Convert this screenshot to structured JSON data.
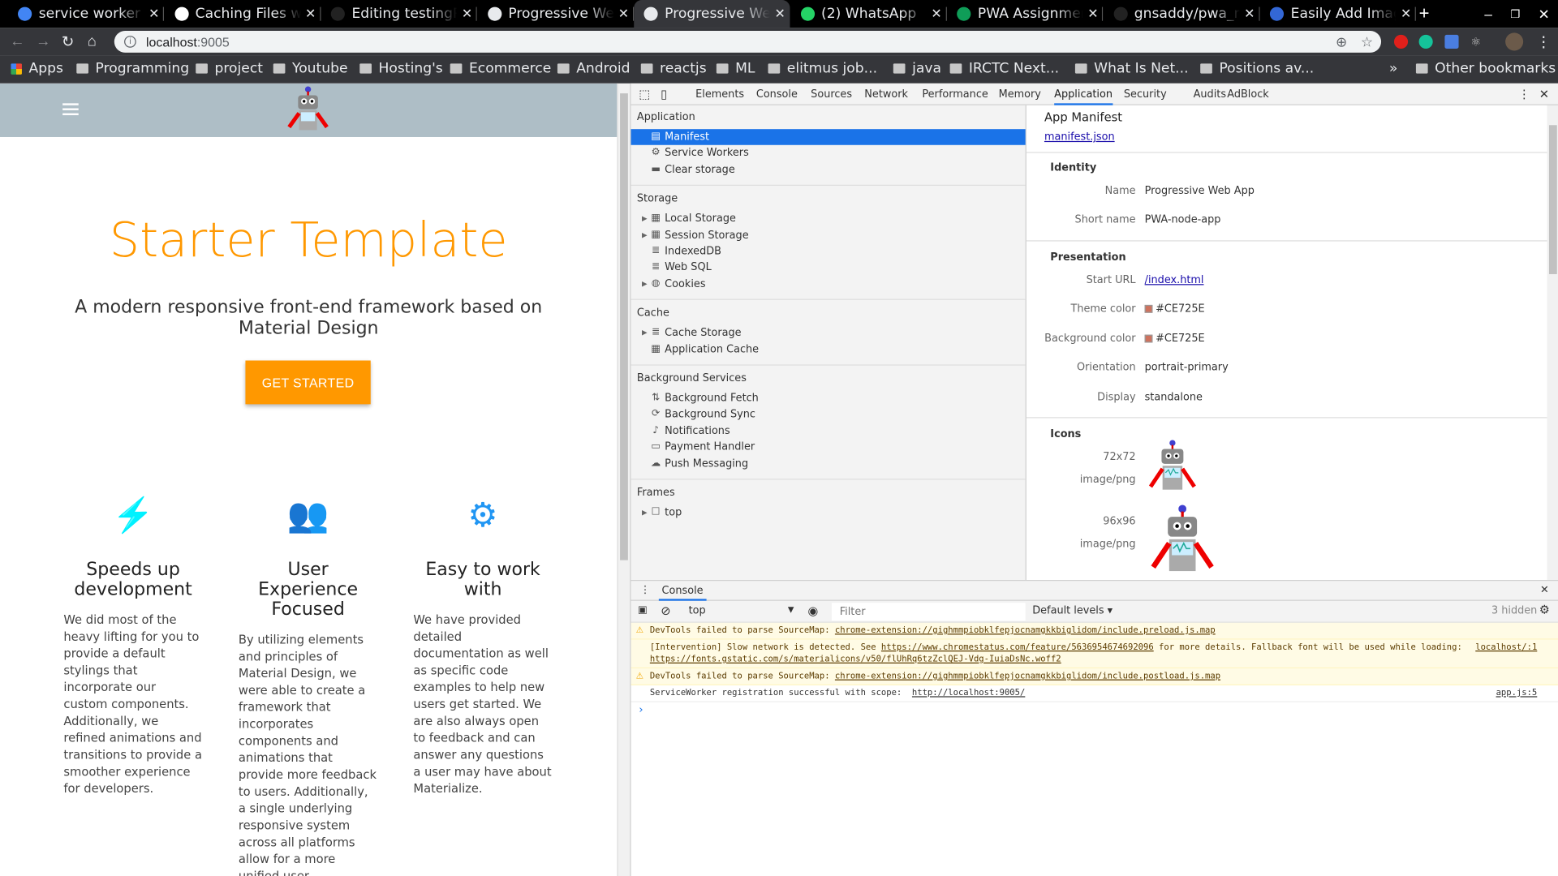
{
  "browser": {
    "tabs": [
      {
        "title": "service worker t",
        "favicon": "google-icon",
        "color": "#4285f4"
      },
      {
        "title": "Caching Files wi",
        "favicon": "web-dev-icon",
        "color": "#ffffff"
      },
      {
        "title": "Editing testingP",
        "favicon": "github-icon",
        "color": "#222222"
      },
      {
        "title": "Progressive Wel",
        "favicon": "globe-icon",
        "color": "#e8eaed"
      },
      {
        "title": "Progressive Wel",
        "favicon": "globe-icon",
        "color": "#e8eaed",
        "active": true
      },
      {
        "title": "(2) WhatsApp",
        "favicon": "whatsapp-icon",
        "color": "#25d366"
      },
      {
        "title": "PWA Assignmen",
        "favicon": "sheets-icon",
        "color": "#0f9d58"
      },
      {
        "title": "gnsaddy/pwa_n",
        "favicon": "github-icon",
        "color": "#222222"
      },
      {
        "title": "Easily Add Imag",
        "favicon": "angular-icon",
        "color": "#3367d6"
      }
    ],
    "url_host": "localhost",
    "url_port": ":9005",
    "bookmarks": [
      "Apps",
      "Programming",
      "project",
      "Youtube",
      "Hosting's",
      "Ecommerce",
      "Android",
      "reactjs",
      "ML",
      "elitmus job...",
      "java",
      "IRCTC Next...",
      "What Is Net...",
      "Positions av..."
    ],
    "other_bookmarks": "Other bookmarks",
    "more": "»"
  },
  "page": {
    "title": "Starter Template",
    "subtitle": "A modern responsive front-end framework based on Material Design",
    "cta": "GET STARTED",
    "accent": "#ff9800",
    "header_color": "#aebec6",
    "features": [
      {
        "icon": "flash-icon",
        "title": "Speeds up development",
        "text": "We did most of the heavy lifting for you to provide a default stylings that incorporate our custom components. Additionally, we refined animations and transitions to provide a smoother experience for developers."
      },
      {
        "icon": "group-icon",
        "title": "User Experience Focused",
        "text": "By utilizing elements and principles of Material Design, we were able to create a framework that incorporates components and animations that provide more feedback to users. Additionally, a single underlying responsive system across all platforms allow for a more unified user experience."
      },
      {
        "icon": "settings-icon",
        "title": "Easy to work with",
        "text": "We have provided detailed documentation as well as specific code examples to help new users get started. We are also always open to feedback and can answer any questions a user may have about Materialize."
      }
    ]
  },
  "devtools": {
    "tabs": [
      "Elements",
      "Console",
      "Sources",
      "Network",
      "Performance",
      "Memory",
      "Application",
      "Security",
      "Audits",
      "AdBlock"
    ],
    "active_tab": "Application",
    "sidebar": [
      {
        "section": "Application",
        "items": [
          {
            "label": "Manifest",
            "icon": "file-icon",
            "selected": true
          },
          {
            "label": "Service Workers",
            "icon": "gear-icon"
          },
          {
            "label": "Clear storage",
            "icon": "trash-icon"
          }
        ]
      },
      {
        "section": "Storage",
        "items": [
          {
            "label": "Local Storage",
            "icon": "grid-icon",
            "expand": true
          },
          {
            "label": "Session Storage",
            "icon": "grid-icon",
            "expand": true
          },
          {
            "label": "IndexedDB",
            "icon": "database-icon"
          },
          {
            "label": "Web SQL",
            "icon": "database-icon"
          },
          {
            "label": "Cookies",
            "icon": "cookie-icon",
            "expand": true
          }
        ]
      },
      {
        "section": "Cache",
        "items": [
          {
            "label": "Cache Storage",
            "icon": "database-icon",
            "expand": true
          },
          {
            "label": "Application Cache",
            "icon": "grid-icon"
          }
        ]
      },
      {
        "section": "Background Services",
        "items": [
          {
            "label": "Background Fetch",
            "icon": "updown-arrows-icon"
          },
          {
            "label": "Background Sync",
            "icon": "sync-icon"
          },
          {
            "label": "Notifications",
            "icon": "bell-icon"
          },
          {
            "label": "Payment Handler",
            "icon": "card-icon"
          },
          {
            "label": "Push Messaging",
            "icon": "cloud-icon"
          }
        ]
      },
      {
        "section": "Frames",
        "items": [
          {
            "label": "top",
            "icon": "frame-icon",
            "expand": true
          }
        ]
      }
    ],
    "manifest": {
      "heading": "App Manifest",
      "link": "manifest.json",
      "identity_label": "Identity",
      "name_label": "Name",
      "name": "Progressive Web App",
      "short_name_label": "Short name",
      "short_name": "PWA-node-app",
      "presentation_label": "Presentation",
      "start_url_label": "Start URL",
      "start_url": "/index.html",
      "theme_color_label": "Theme color",
      "theme_color": "#CE725E",
      "background_color_label": "Background color",
      "background_color": "#CE725E",
      "orientation_label": "Orientation",
      "orientation": "portrait-primary",
      "display_label": "Display",
      "display": "standalone",
      "icons_label": "Icons",
      "icons": [
        {
          "size": "72x72",
          "type": "image/png"
        },
        {
          "size": "96x96",
          "type": "image/png"
        }
      ]
    },
    "console": {
      "tab": "Console",
      "context": "top",
      "filter_placeholder": "Filter",
      "levels": "Default levels ▾",
      "hidden": "3 hidden",
      "messages": [
        {
          "level": "warning",
          "text": "DevTools failed to parse SourceMap: ",
          "link": "chrome-extension://gighmmpiobklfepjocnamgkkbiglidom/include.preload.js.map"
        },
        {
          "level": "warning",
          "text": "[Intervention] Slow network is detected. See ",
          "link": "https://www.chromestatus.com/feature/5636954674692096",
          "text2": " for more details. Fallback font will be used while loading: ",
          "link2": "https://fonts.gstatic.com/s/materialicons/v50/flUhRq6tzZclQEJ-Vdg-IuiaDsNc.woff2",
          "source": "localhost/:1",
          "noicon": true
        },
        {
          "level": "warning",
          "text": "DevTools failed to parse SourceMap: ",
          "link": "chrome-extension://gighmmpiobklfepjocnamgkkbiglidom/include.postload.js.map"
        },
        {
          "level": "info",
          "text": "ServiceWorker registration successful with scope:  ",
          "link": "http://localhost:9005/",
          "source": "app.js:5"
        }
      ],
      "prompt": "›"
    }
  }
}
